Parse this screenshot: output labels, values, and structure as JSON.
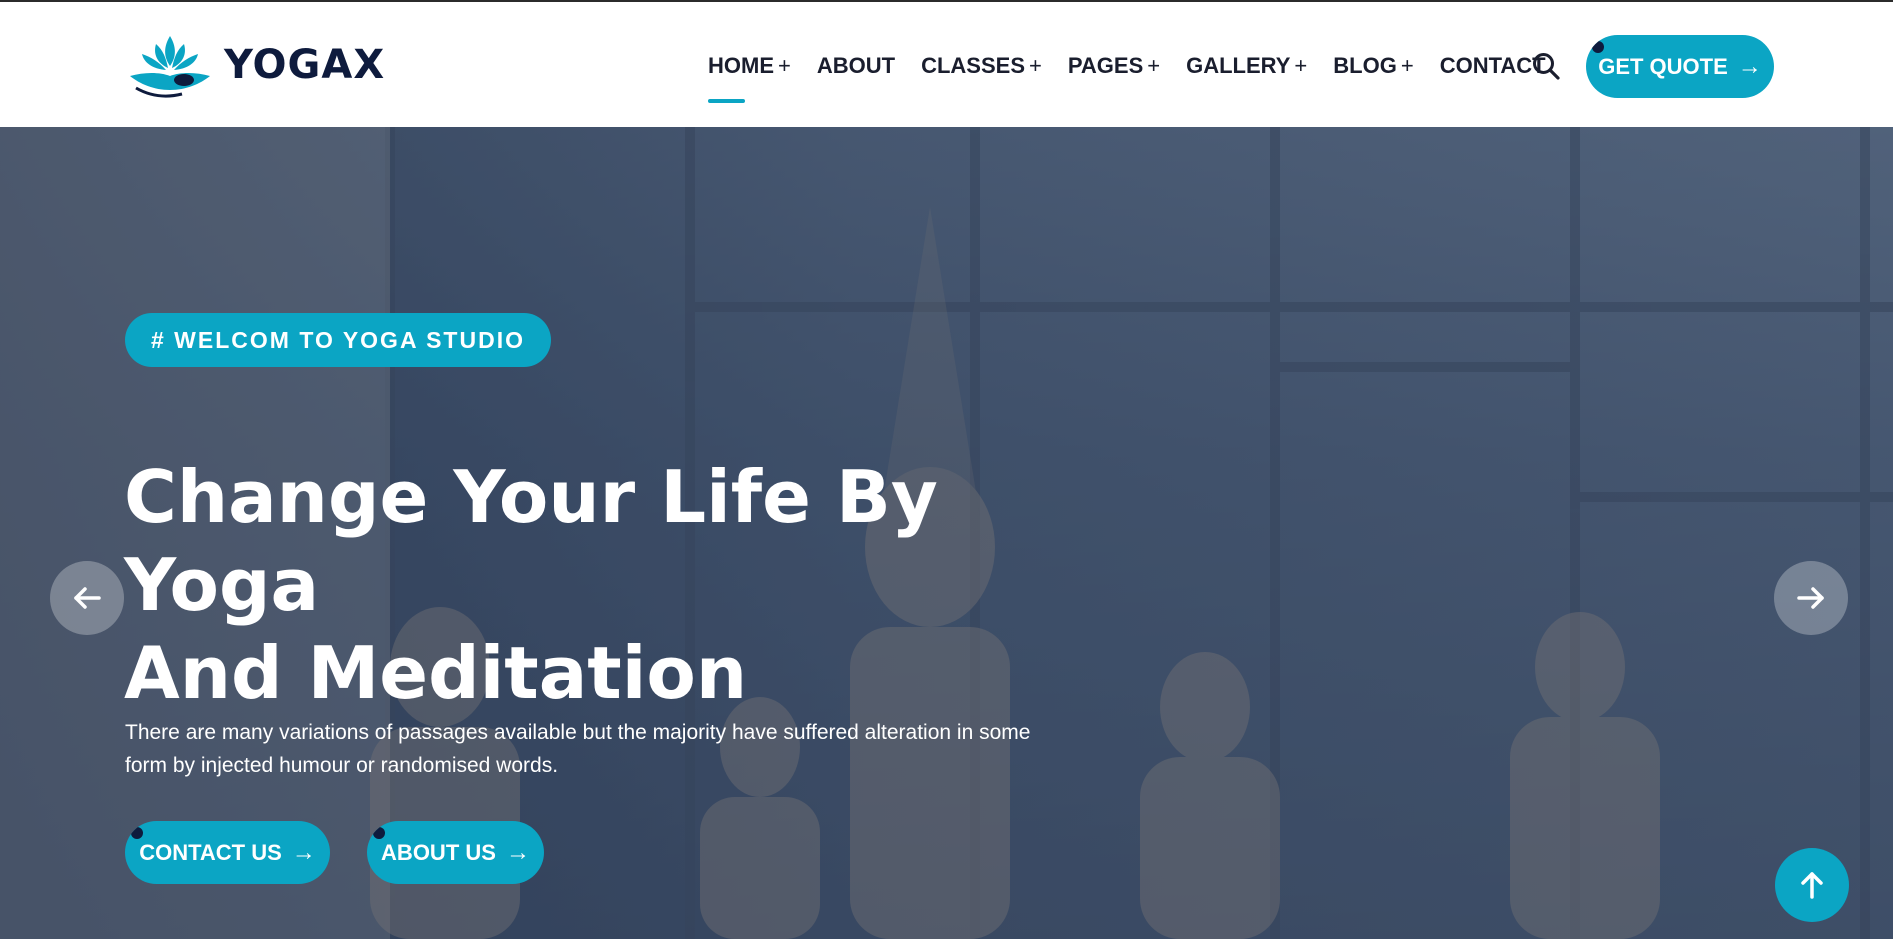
{
  "brand": {
    "name": "YOGAX",
    "accent_color": "#0ba5c4",
    "dark_color": "#0e1b3d",
    "logo_icon": "lotus-icon"
  },
  "nav": {
    "items": [
      {
        "label": "HOME",
        "plus": "+",
        "active": true
      },
      {
        "label": "ABOUT",
        "plus": ""
      },
      {
        "label": "CLASSES",
        "plus": "+"
      },
      {
        "label": "PAGES",
        "plus": "+"
      },
      {
        "label": "GALLERY",
        "plus": "+"
      },
      {
        "label": "BLOG",
        "plus": "+"
      },
      {
        "label": "CONTACT",
        "plus": ""
      }
    ],
    "search_icon": "search-icon",
    "quote_button": {
      "label": "GET QUOTE",
      "icon": "arrow-right-icon"
    }
  },
  "hero": {
    "badge": "# WELCOM TO YOGA STUDIO",
    "title_line1": "Change Your Life By Yoga",
    "title_line2": "And Meditation",
    "description_line1": "There are many variations of passages available but the majority have suffered alteration in some",
    "description_line2": "form by injected humour or randomised words.",
    "buttons": [
      {
        "label": "CONTACT US",
        "icon": "arrow-right-icon"
      },
      {
        "label": "ABOUT US",
        "icon": "arrow-right-icon"
      }
    ],
    "prev_icon": "arrow-left-icon",
    "next_icon": "arrow-right-icon",
    "background_image": "yoga-class-photo"
  },
  "scroll_top": {
    "icon": "arrow-up-icon"
  }
}
